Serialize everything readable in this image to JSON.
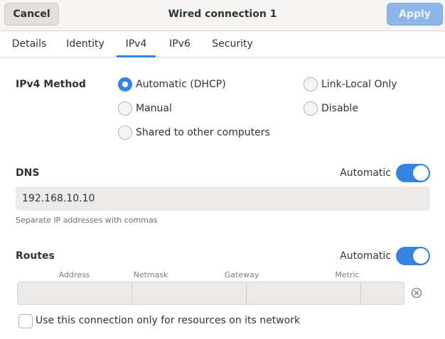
{
  "header": {
    "cancel_label": "Cancel",
    "title": "Wired connection 1",
    "apply_label": "Apply"
  },
  "tabs": [
    {
      "label": "Details",
      "active": false
    },
    {
      "label": "Identity",
      "active": false
    },
    {
      "label": "IPv4",
      "active": true
    },
    {
      "label": "IPv6",
      "active": false
    },
    {
      "label": "Security",
      "active": false
    }
  ],
  "method": {
    "label": "IPv4 Method",
    "options": [
      {
        "label": "Automatic (DHCP)",
        "checked": true
      },
      {
        "label": "Link-Local Only",
        "checked": false
      },
      {
        "label": "Manual",
        "checked": false
      },
      {
        "label": "Disable",
        "checked": false
      },
      {
        "label": "Shared to other computers",
        "checked": false
      }
    ]
  },
  "dns": {
    "label": "DNS",
    "automatic_label": "Automatic",
    "automatic_on": true,
    "value": "192.168.10.10",
    "hint": "Separate IP addresses with commas"
  },
  "routes": {
    "label": "Routes",
    "automatic_label": "Automatic",
    "automatic_on": true,
    "columns": [
      "Address",
      "Netmask",
      "Gateway",
      "Metric"
    ],
    "values": [
      "",
      "",
      "",
      ""
    ],
    "clear_icon": "edit-clear-icon"
  },
  "only_resources": {
    "label": "Use this connection only for resources on its network",
    "checked": false
  },
  "colors": {
    "accent": "#3584e4",
    "apply_disabled": "#8fb5e6"
  }
}
